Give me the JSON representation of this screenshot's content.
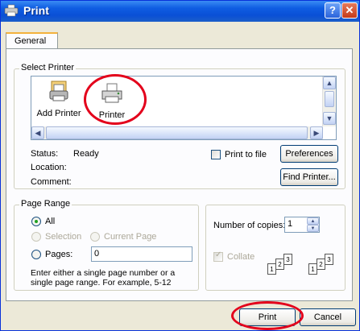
{
  "window": {
    "title": "Print",
    "help_label": "?",
    "close_label": "✕"
  },
  "tabs": [
    {
      "label": "General"
    }
  ],
  "select_printer": {
    "legend": "Select Printer",
    "printers": [
      {
        "label": "Add Printer",
        "icon": "add-printer-icon"
      },
      {
        "label": "Printer",
        "icon": "printer-icon"
      }
    ],
    "status_label": "Status:",
    "status_value": "Ready",
    "location_label": "Location:",
    "comment_label": "Comment:",
    "print_to_file_label": "Print to file",
    "preferences_label": "Preferences",
    "find_printer_label": "Find Printer..."
  },
  "page_range": {
    "legend": "Page Range",
    "all_label": "All",
    "selection_label": "Selection",
    "current_page_label": "Current Page",
    "pages_label": "Pages:",
    "pages_value": "0",
    "help_text": "Enter either a single page number or a single page range.  For example, 5-12"
  },
  "copies": {
    "number_label": "Number of copies:",
    "number_value": "1",
    "collate_label": "Collate",
    "collate_pages": [
      "1",
      "2",
      "3",
      "1",
      "2",
      "3"
    ]
  },
  "footer": {
    "print_label": "Print",
    "cancel_label": "Cancel"
  },
  "colors": {
    "titlebar": "#0a50d6",
    "highlight": "#e3001b",
    "dialog_bg": "#ece9d8"
  }
}
